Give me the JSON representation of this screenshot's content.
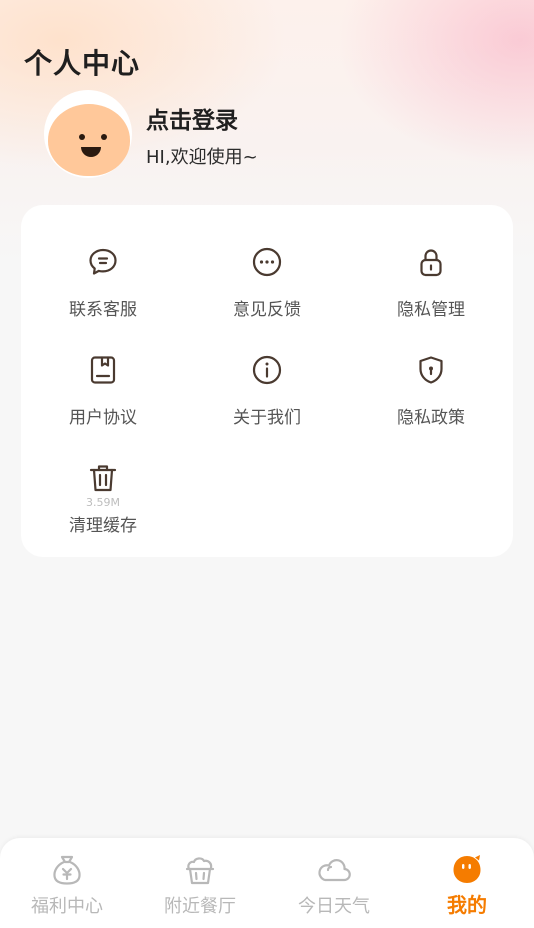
{
  "header": {
    "title": "个人中心",
    "login_title": "点击登录",
    "login_subtitle": "HI,欢迎使用~"
  },
  "menu": {
    "items": [
      {
        "label": "联系客服",
        "icon": "chat-bubble-icon"
      },
      {
        "label": "意见反馈",
        "icon": "feedback-dots-icon"
      },
      {
        "label": "隐私管理",
        "icon": "lock-icon"
      },
      {
        "label": "用户协议",
        "icon": "agreement-book-icon"
      },
      {
        "label": "关于我们",
        "icon": "info-icon"
      },
      {
        "label": "隐私政策",
        "icon": "shield-icon"
      },
      {
        "label": "清理缓存",
        "icon": "trash-icon",
        "size": "3.59M"
      }
    ]
  },
  "tabbar": {
    "tabs": [
      {
        "label": "福利中心",
        "icon": "money-bag-icon",
        "active": false
      },
      {
        "label": "附近餐厅",
        "icon": "restaurant-icon",
        "active": false
      },
      {
        "label": "今日天气",
        "icon": "cloud-icon",
        "active": false
      },
      {
        "label": "我的",
        "icon": "mascot-icon",
        "active": true
      }
    ]
  },
  "colors": {
    "accent": "#f57c00",
    "inactive_tab": "#b8b8b8",
    "card_bg": "#ffffff",
    "page_bg": "#f7f7f7"
  }
}
